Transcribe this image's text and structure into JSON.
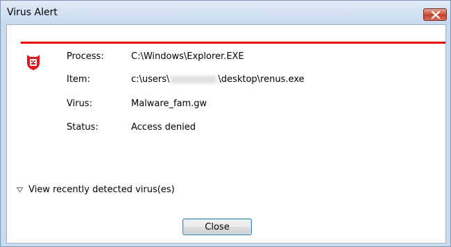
{
  "window": {
    "title": "Virus Alert"
  },
  "alert": {
    "accent_color": "#e10000",
    "icon": "shield-virus-icon",
    "process_label": "Process:",
    "process_value": "C:\\Windows\\Explorer.EXE",
    "item_label": "Item:",
    "item_value_prefix": "c:\\users\\",
    "item_value_suffix": "\\desktop\\renus.exe",
    "virus_label": "Virus:",
    "virus_value": "Malware_fam.gw",
    "status_label": "Status:",
    "status_value": "Access denied"
  },
  "details": {
    "expander_label": "View recently detected virus(es)"
  },
  "buttons": {
    "close_label": "Close"
  }
}
